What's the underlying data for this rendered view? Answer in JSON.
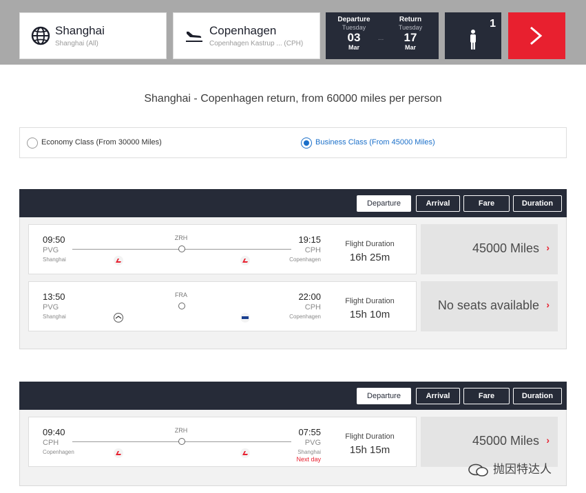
{
  "search": {
    "origin": {
      "city": "Shanghai",
      "sub": "Shanghai (All)"
    },
    "destination": {
      "city": "Copenhagen",
      "sub": "Copenhagen Kastrup ... (CPH)"
    },
    "departure": {
      "label": "Departure",
      "dow": "Tuesday",
      "day": "03",
      "month": "Mar"
    },
    "return": {
      "label": "Return",
      "dow": "Tuesday",
      "day": "17",
      "month": "Mar"
    },
    "dots": "...",
    "passengers": "1"
  },
  "route_title": "Shanghai - Copenhagen return, from 60000 miles per person",
  "classes": {
    "economy": "Economy Class (From 30000 Miles)",
    "business": "Business Class (From 45000 Miles)",
    "selected": "business"
  },
  "sort_buttons": [
    "Departure",
    "Arrival",
    "Fare",
    "Duration"
  ],
  "duration_label": "Flight Duration",
  "outbound": [
    {
      "dep_time": "09:50",
      "dep_code": "PVG",
      "dep_city": "Shanghai",
      "stop": "ZRH",
      "arr_time": "19:15",
      "arr_code": "CPH",
      "arr_city": "Copenhagen",
      "duration": "16h 25m",
      "price": "45000 Miles"
    },
    {
      "dep_time": "13:50",
      "dep_code": "PVG",
      "dep_city": "Shanghai",
      "stop": "FRA",
      "arr_time": "22:00",
      "arr_code": "CPH",
      "arr_city": "Copenhagen",
      "duration": "15h 10m",
      "price": "No seats available"
    }
  ],
  "inbound": [
    {
      "dep_time": "09:40",
      "dep_code": "CPH",
      "dep_city": "Copenhagen",
      "stop": "ZRH",
      "arr_time": "07:55",
      "arr_code": "PVG",
      "arr_city": "Shanghai",
      "next_day": "Next day",
      "duration": "15h 15m",
      "price": "45000 Miles"
    }
  ],
  "watermark": "抛因特达人",
  "colors": {
    "brand_red": "#e8202f",
    "dark_bar": "#262b38",
    "selected_blue": "#1a6fc9"
  }
}
